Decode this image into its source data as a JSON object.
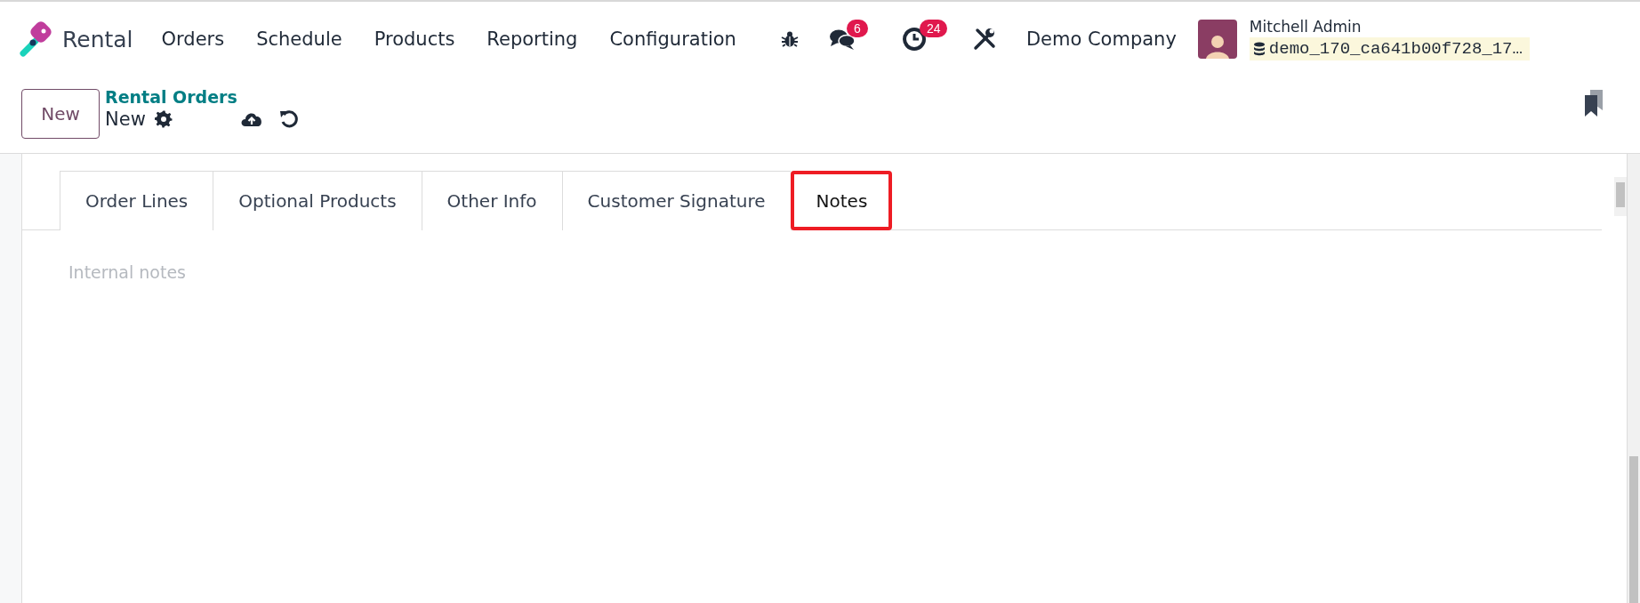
{
  "app": {
    "name": "Rental"
  },
  "menu": [
    "Orders",
    "Schedule",
    "Products",
    "Reporting",
    "Configuration"
  ],
  "systray": {
    "messages_badge": "6",
    "activities_badge": "24",
    "company": "Demo Company",
    "user": {
      "name": "Mitchell Admin",
      "database": "demo_170_ca641b00f728_17…"
    }
  },
  "control_panel": {
    "new_button": "New",
    "breadcrumb": "Rental Orders",
    "record": "New"
  },
  "tabs": [
    {
      "label": "Order Lines",
      "selected": false,
      "highlighted": false
    },
    {
      "label": "Optional Products",
      "selected": false,
      "highlighted": false
    },
    {
      "label": "Other Info",
      "selected": false,
      "highlighted": false
    },
    {
      "label": "Customer Signature",
      "selected": false,
      "highlighted": false
    },
    {
      "label": "Notes",
      "selected": true,
      "highlighted": true
    }
  ],
  "notes": {
    "placeholder": "Internal notes"
  }
}
